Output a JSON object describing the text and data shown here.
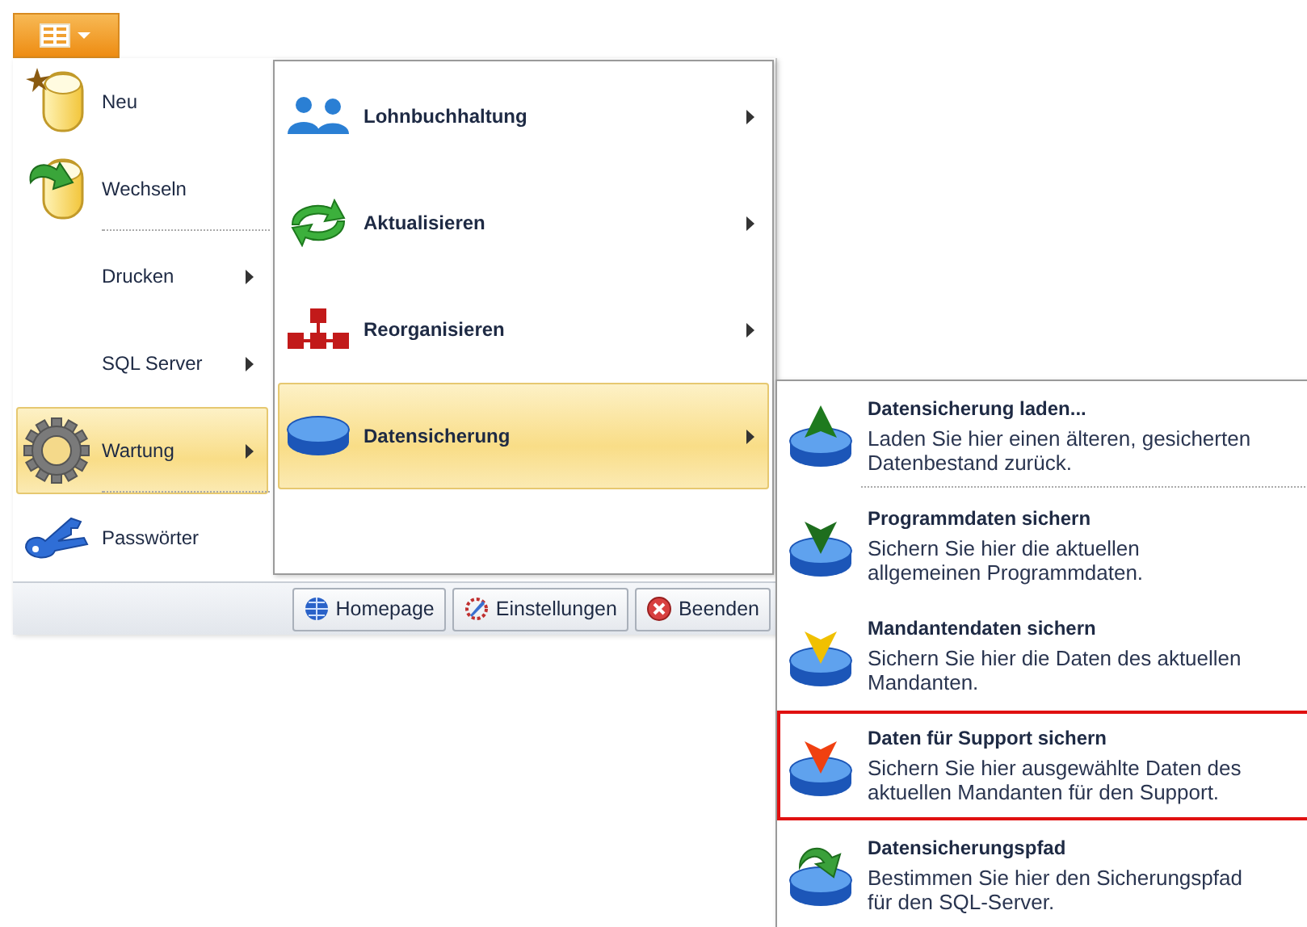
{
  "menu_button": {
    "expanded": true
  },
  "main_menu": {
    "items": [
      {
        "label": "Neu",
        "has_submenu": false,
        "selected": false,
        "separator_after": false
      },
      {
        "label": "Wechseln",
        "has_submenu": false,
        "selected": false,
        "separator_after": true
      },
      {
        "label": "Drucken",
        "has_submenu": true,
        "selected": false,
        "separator_after": false
      },
      {
        "label": "SQL Server",
        "has_submenu": true,
        "selected": false,
        "separator_after": false
      },
      {
        "label": "Wartung",
        "has_submenu": true,
        "selected": true,
        "separator_after": true
      },
      {
        "label": "Passwörter",
        "has_submenu": false,
        "selected": false,
        "separator_after": false
      }
    ]
  },
  "footer_buttons": [
    "Homepage",
    "Einstellungen",
    "Beenden"
  ],
  "wartung_menu": {
    "items": [
      {
        "label": "Lohnbuchhaltung",
        "has_submenu": true,
        "selected": false
      },
      {
        "label": "Aktualisieren",
        "has_submenu": true,
        "selected": false
      },
      {
        "label": "Reorganisieren",
        "has_submenu": true,
        "selected": false
      },
      {
        "label": "Datensicherung",
        "has_submenu": true,
        "selected": true
      }
    ]
  },
  "datensicherung_menu": {
    "items": [
      {
        "title": "Datensicherung laden...",
        "description": "Laden Sie hier einen älteren, gesicherten Datenbestand zurück.",
        "highlighted": false,
        "separator_after": true
      },
      {
        "title": "Programmdaten sichern",
        "description": "Sichern Sie hier die aktuellen allgemeinen Programmdaten.",
        "highlighted": false,
        "separator_after": false
      },
      {
        "title": "Mandantendaten sichern",
        "description": "Sichern Sie hier die Daten des aktuellen Mandanten.",
        "highlighted": false,
        "separator_after": false
      },
      {
        "title": "Daten für Support sichern",
        "description": "Sichern Sie hier ausgewählte Daten des aktuellen Mandanten für den Support.",
        "highlighted": true,
        "separator_after": false
      },
      {
        "title": "Datensicherungspfad",
        "description": "Bestimmen Sie hier den Sicherungspfad für den SQL-Server.",
        "highlighted": false,
        "separator_after": false
      }
    ]
  }
}
